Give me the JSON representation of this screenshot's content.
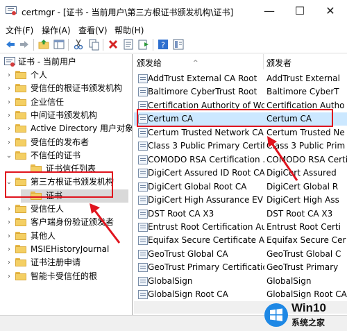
{
  "window": {
    "title": "certmgr - [证书 - 当前用户\\第三方根证书颁发机构\\证书]",
    "minimize": "—",
    "maximize": "☐",
    "close": "✕"
  },
  "menu": [
    "文件(F)",
    "操作(A)",
    "查看(V)",
    "帮助(H)"
  ],
  "toolbar_icons": [
    "back-arrow-icon",
    "forward-arrow-icon",
    "up-folder-icon",
    "show-hide-tree-icon",
    "cut-icon",
    "copy-icon",
    "delete-icon",
    "properties-icon",
    "refresh-icon",
    "export-list-icon",
    "help-icon",
    "mmc-icon"
  ],
  "tree": {
    "root": "证书 - 当前用户",
    "items": [
      {
        "label": "个人",
        "level": 1,
        "expanded": false
      },
      {
        "label": "受信任的根证书颁发机构",
        "level": 1,
        "expanded": false
      },
      {
        "label": "企业信任",
        "level": 1,
        "expanded": false
      },
      {
        "label": "中间证书颁发机构",
        "level": 1,
        "expanded": false
      },
      {
        "label": "Active Directory 用户对象",
        "level": 1,
        "expanded": false
      },
      {
        "label": "受信任的发布者",
        "level": 1,
        "expanded": false
      },
      {
        "label": "不信任的证书",
        "level": 1,
        "expanded": true
      },
      {
        "label": "证书信任列表",
        "level": 2,
        "expanded": null
      },
      {
        "label": "第三方根证书颁发机构",
        "level": 1,
        "expanded": true
      },
      {
        "label": "证书",
        "level": 2,
        "expanded": null,
        "selected": true
      },
      {
        "label": "受信任人",
        "level": 1,
        "expanded": false
      },
      {
        "label": "客户端身份验证颁发者",
        "level": 1,
        "expanded": false
      },
      {
        "label": "其他人",
        "level": 1,
        "expanded": false
      },
      {
        "label": "MSIEHistoryJournal",
        "level": 1,
        "expanded": false
      },
      {
        "label": "证书注册申请",
        "level": 1,
        "expanded": false
      },
      {
        "label": "智能卡受信任的根",
        "level": 1,
        "expanded": false
      }
    ]
  },
  "list": {
    "headers": [
      "颁发给",
      "颁发者"
    ],
    "rows": [
      [
        "AddTrust External CA Root",
        "AddTrust External"
      ],
      [
        "Baltimore CyberTrust Root",
        "Baltimore CyberT"
      ],
      [
        "Certification Authority of Wo...",
        "Certification Autho"
      ],
      [
        "Certum CA",
        "Certum CA"
      ],
      [
        "Certum Trusted Network CA",
        "Certum Trusted Ne"
      ],
      [
        "Class 3 Public Primary Certifi...",
        "Class 3 Public Prim"
      ],
      [
        "COMODO RSA Certification ...",
        "COMODO RSA Certi"
      ],
      [
        "DigiCert Assured ID Root CA",
        "DigiCert Assured"
      ],
      [
        "DigiCert Global Root CA",
        "DigiCert Global R"
      ],
      [
        "DigiCert High Assurance EV ...",
        "DigiCert High Ass"
      ],
      [
        "DST Root CA X3",
        "DST Root CA X3"
      ],
      [
        "Entrust Root Certification Au...",
        "Entrust Root Certi"
      ],
      [
        "Equifax Secure Certificate Au...",
        "Equifax Secure Cer"
      ],
      [
        "GeoTrust Global CA",
        "GeoTrust Global C"
      ],
      [
        "GeoTrust Primary Certificatio...",
        "GeoTrust Primary"
      ],
      [
        "GlobalSign",
        "GlobalSign"
      ],
      [
        "GlobalSign Root CA",
        "GlobalSign Root CA"
      ]
    ],
    "selected_index": 3
  },
  "watermark": {
    "brand": "Win10",
    "site": "系统之家"
  },
  "colors": {
    "annotation": "#e0141e",
    "selection": "#cce8ff",
    "folder": "#f4cf63"
  }
}
